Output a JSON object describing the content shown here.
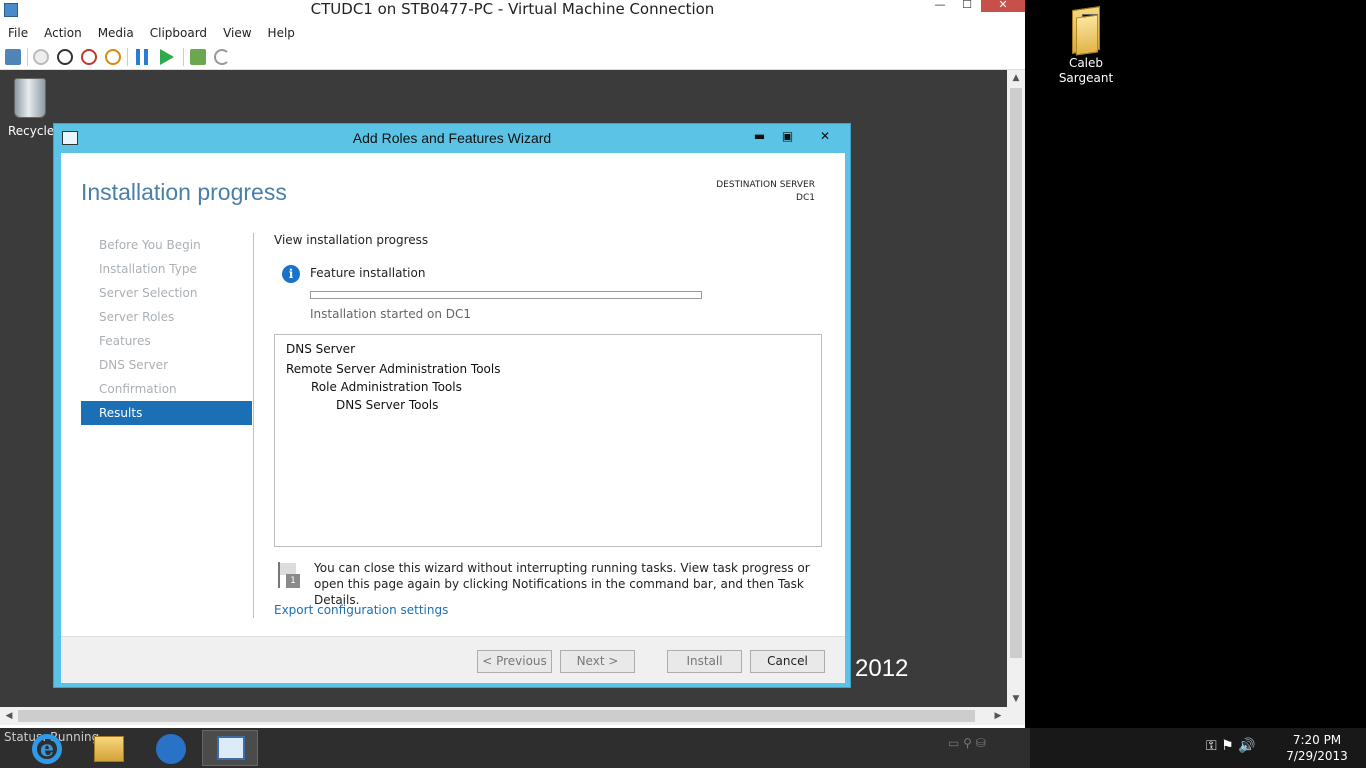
{
  "vm_window": {
    "title": "CTUDC1 on STB0477-PC - Virtual Machine Connection",
    "menu": [
      "File",
      "Action",
      "Media",
      "Clipboard",
      "View",
      "Help"
    ],
    "controls": {
      "minimize": "—",
      "maximize": "☐",
      "close": "✕"
    }
  },
  "guest_desktop": {
    "recycle_label": "Recycle",
    "watermark": "2012"
  },
  "host_desktop": {
    "folder_label_line1": "Caleb",
    "folder_label_line2": "Sargeant"
  },
  "wizard": {
    "title": "Add Roles and Features Wizard",
    "heading": "Installation progress",
    "destination_label": "DESTINATION SERVER",
    "destination_value": "DC1",
    "nav": [
      {
        "label": "Before You Begin",
        "active": false
      },
      {
        "label": "Installation Type",
        "active": false
      },
      {
        "label": "Server Selection",
        "active": false
      },
      {
        "label": "Server Roles",
        "active": false
      },
      {
        "label": "Features",
        "active": false
      },
      {
        "label": "DNS Server",
        "active": false
      },
      {
        "label": "Confirmation",
        "active": false
      },
      {
        "label": "Results",
        "active": true
      }
    ],
    "view_progress_label": "View installation progress",
    "feature_installation_label": "Feature installation",
    "progress_fraction": 0.0,
    "status_text": "Installation started on DC1",
    "results": [
      {
        "text": "DNS Server",
        "level": 0
      },
      {
        "text": "Remote Server Administration Tools",
        "level": 0
      },
      {
        "text": "Role Administration Tools",
        "level": 1
      },
      {
        "text": "DNS Server Tools",
        "level": 2
      }
    ],
    "note_text": "You can close this wizard without interrupting running tasks. View task progress or open this page again by clicking Notifications in the command bar, and then Task Details.",
    "note_badge": "1",
    "export_link": "Export configuration settings",
    "buttons": {
      "previous": "< Previous",
      "next": "Next >",
      "install": "Install",
      "cancel": "Cancel"
    }
  },
  "statusbar": {
    "text": "Status: Running"
  },
  "taskbar": {
    "time": "7:20 PM",
    "date": "7/29/2013"
  },
  "colors": {
    "wizard_frame": "#5bc4e6",
    "active_nav": "#1a6fb5",
    "heading": "#4a7fa6",
    "link": "#1a6fb5"
  }
}
